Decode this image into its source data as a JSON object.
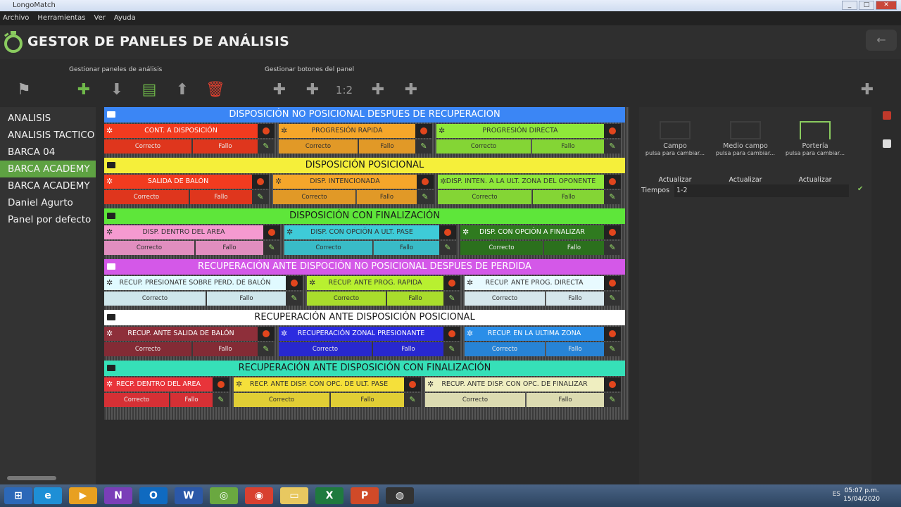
{
  "window": {
    "title": "LongoMatch",
    "controls": [
      "_",
      "□",
      "✕"
    ]
  },
  "menu": [
    "Archivo",
    "Herramientas",
    "Ver",
    "Ayuda"
  ],
  "header": {
    "title": "GESTOR DE PANELES DE ANÁLISIS",
    "back_icon": "←"
  },
  "toolbar": {
    "group1_label": "Gestionar paneles de análisis",
    "group2_label": "Gestionar botones del panel",
    "icons": {
      "team": "⚑",
      "add": "✚",
      "import": "⬇",
      "save": "▤",
      "export": "⬆",
      "delete": "🗑",
      "b_tag": "✚",
      "b_label": "✚",
      "b_score": "1:2",
      "b_card": "✚",
      "b_timer": "✚",
      "b_play": "✚"
    }
  },
  "sidebar": {
    "items": [
      "ANALISIS",
      "ANALISIS TACTICO",
      "BARCA 04",
      "BARCA ACADEMY",
      "BARCA ACADEMY",
      "Daniel Agurto",
      "Panel por defecto"
    ]
  },
  "panel": {
    "bands": [
      {
        "label": "DISPOSICIÓN NO POSICIONAL DESPUES DE RECUPERACION",
        "color": "#3b86f5",
        "text_color": "#ffffff"
      },
      {
        "label": "DISPOSICIÓN POSICIONAL",
        "color": "#f5ef3a",
        "text_color": "#1a1a1a"
      },
      {
        "label": "DISPOSICIÓN CON FINALIZACIÓN",
        "color": "#5ee63a",
        "text_color": "#1a1a1a"
      },
      {
        "label": "RECUPERACIÓN ANTE DISPOCIÓN NO POSICIONAL DESPUES DE PERDIDA",
        "color": "#d458e8",
        "text_color": "#ffffff"
      },
      {
        "label": "RECUPERACIÓN ANTE DISPOSICIÓN POSICIONAL",
        "color": "#ffffff",
        "text_color": "#1a1a1a"
      },
      {
        "label": "RECUPERACIÓN ANTE DISPOSICIÓN CON FINALIZACIÓN",
        "color": "#36e0b8",
        "text_color": "#1a1a1a"
      }
    ],
    "cells": [
      {
        "name": "CONT. A DISPOSICIÓN",
        "color": "#f23b1f",
        "ok": "Correcto",
        "fail": "Fallo"
      },
      {
        "name": "PROGRESIÓN RAPIDA",
        "color": "#f5a62a",
        "ok": "Correcto",
        "fail": "Fallo"
      },
      {
        "name": "PROGRESIÓN DIRECTA",
        "color": "#8fe83a",
        "ok": "Correcto",
        "fail": "Fallo"
      },
      {
        "name": "SALIDA DE BALÓN",
        "color": "#f23b1f",
        "ok": "Correcto",
        "fail": "Fallo"
      },
      {
        "name": "DISP. INTENCIONADA",
        "color": "#f5a62a",
        "ok": "Correcto",
        "fail": "Fallo"
      },
      {
        "name": "DISP. INTEN. A LA ULT. ZONA DEL OPONENTE",
        "color": "#8fe83a",
        "ok": "Correcto",
        "fail": "Fallo"
      },
      {
        "name": "DISP. DENTRO DEL AREA",
        "color": "#f59ad0",
        "ok": "Correcto",
        "fail": "Fallo"
      },
      {
        "name": "DISP. CON OPCIÓN A ULT. PASE",
        "color": "#3ecbd8",
        "ok": "Correcto",
        "fail": "Fallo"
      },
      {
        "name": "DISP. CON OPCIÓN A FINALIZAR",
        "color": "#2f7a1f",
        "ok": "Correcto",
        "fail": "Fallo"
      },
      {
        "name": "RECUP. PRESIONATE SOBRE PERD. DE BALÓN",
        "color": "#e0faff",
        "ok": "Correcto",
        "fail": "Fallo"
      },
      {
        "name": "RECUP. ANTE PROG. RAPIDA",
        "color": "#b8f030",
        "ok": "Correcto",
        "fail": "Fallo"
      },
      {
        "name": "RECUP. ANTE PROG. DIRECTA",
        "color": "#e8faff",
        "ok": "Correcto",
        "fail": "Fallo"
      },
      {
        "name": "RECUP. ANTE SALIDA DE BALÓN",
        "color": "#8e2f3a",
        "ok": "Correcto",
        "fail": "Fallo"
      },
      {
        "name": "RECUPERACIÓN ZONAL PRESIONANTE",
        "color": "#2c2ce0",
        "ok": "Correcto",
        "fail": "Fallo"
      },
      {
        "name": "RECUP. EN LA ULTIMA ZONA",
        "color": "#2a8ee8",
        "ok": "Correcto",
        "fail": "Fallo"
      },
      {
        "name": "RECP. DENTRO DEL AREA",
        "color": "#e8343a",
        "ok": "Correcto",
        "fail": "Fallo"
      },
      {
        "name": "RECP. ANTE DISP. CON OPC. DE ULT. PASE",
        "color": "#f5e03a",
        "ok": "Correcto",
        "fail": "Fallo"
      },
      {
        "name": "RECUP. ANTE DISP. CON OPC. DE FINALIZAR",
        "color": "#efeec0",
        "ok": "Correcto",
        "fail": "Fallo"
      }
    ]
  },
  "properties": {
    "fields": [
      {
        "name": "Campo",
        "sub": "pulsa para cambiar...",
        "btn": "Actualizar"
      },
      {
        "name": "Medio campo",
        "sub": "pulsa para cambiar...",
        "btn": "Actualizar"
      },
      {
        "name": "Portería",
        "sub": "pulsa para cambiar...",
        "btn": "Actualizar"
      }
    ],
    "tiempos_label": "Tiempos",
    "tiempos_value": "1-2"
  },
  "taskbar": {
    "apps": [
      "⊞",
      "e",
      "▶",
      "N",
      "O",
      "W",
      "◎",
      "◉",
      "▭",
      "X",
      "P",
      "◍"
    ],
    "app_colors": [
      "#2c68b8",
      "#1e8fd6",
      "#e8a020",
      "#7a3eb8",
      "#0f6ac0",
      "#2b58a8",
      "#6aa840",
      "#d84030",
      "#e8c860",
      "#1f7a3e",
      "#d04a28",
      "#333333"
    ],
    "tray": "ES",
    "time": "05:07 p.m.",
    "date": "15/04/2020"
  }
}
